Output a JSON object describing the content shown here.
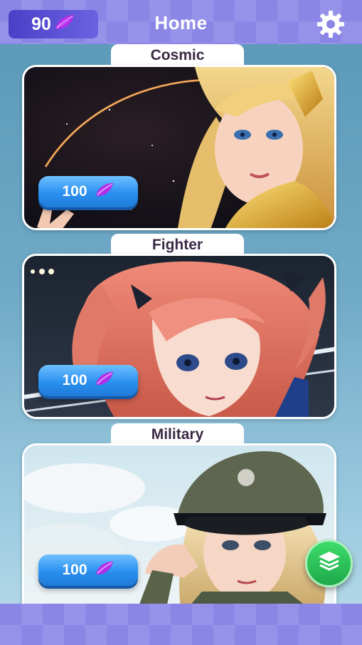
{
  "header": {
    "title": "Home",
    "currency_amount": "90",
    "currency_icon": "purple-gem-icon",
    "settings_icon": "gear-icon"
  },
  "cards": [
    {
      "label": "Cosmic",
      "price": "100",
      "price_icon": "purple-gem-icon",
      "theme": "golden-armored-heroine"
    },
    {
      "label": "Fighter",
      "price": "100",
      "price_icon": "purple-gem-icon",
      "theme": "pink-haired-fighter"
    },
    {
      "label": "Military",
      "price": "100",
      "price_icon": "purple-gem-icon",
      "theme": "officer-cap-soldier"
    }
  ],
  "fab": {
    "icon": "layers-icon"
  },
  "colors": {
    "bar": "#8b86e6",
    "currency_bg": "#4a40c8",
    "price_button": "#2a90f0",
    "gem": "#b02ee8",
    "fab": "#1ea84a",
    "label_text": "#3a2a45"
  }
}
